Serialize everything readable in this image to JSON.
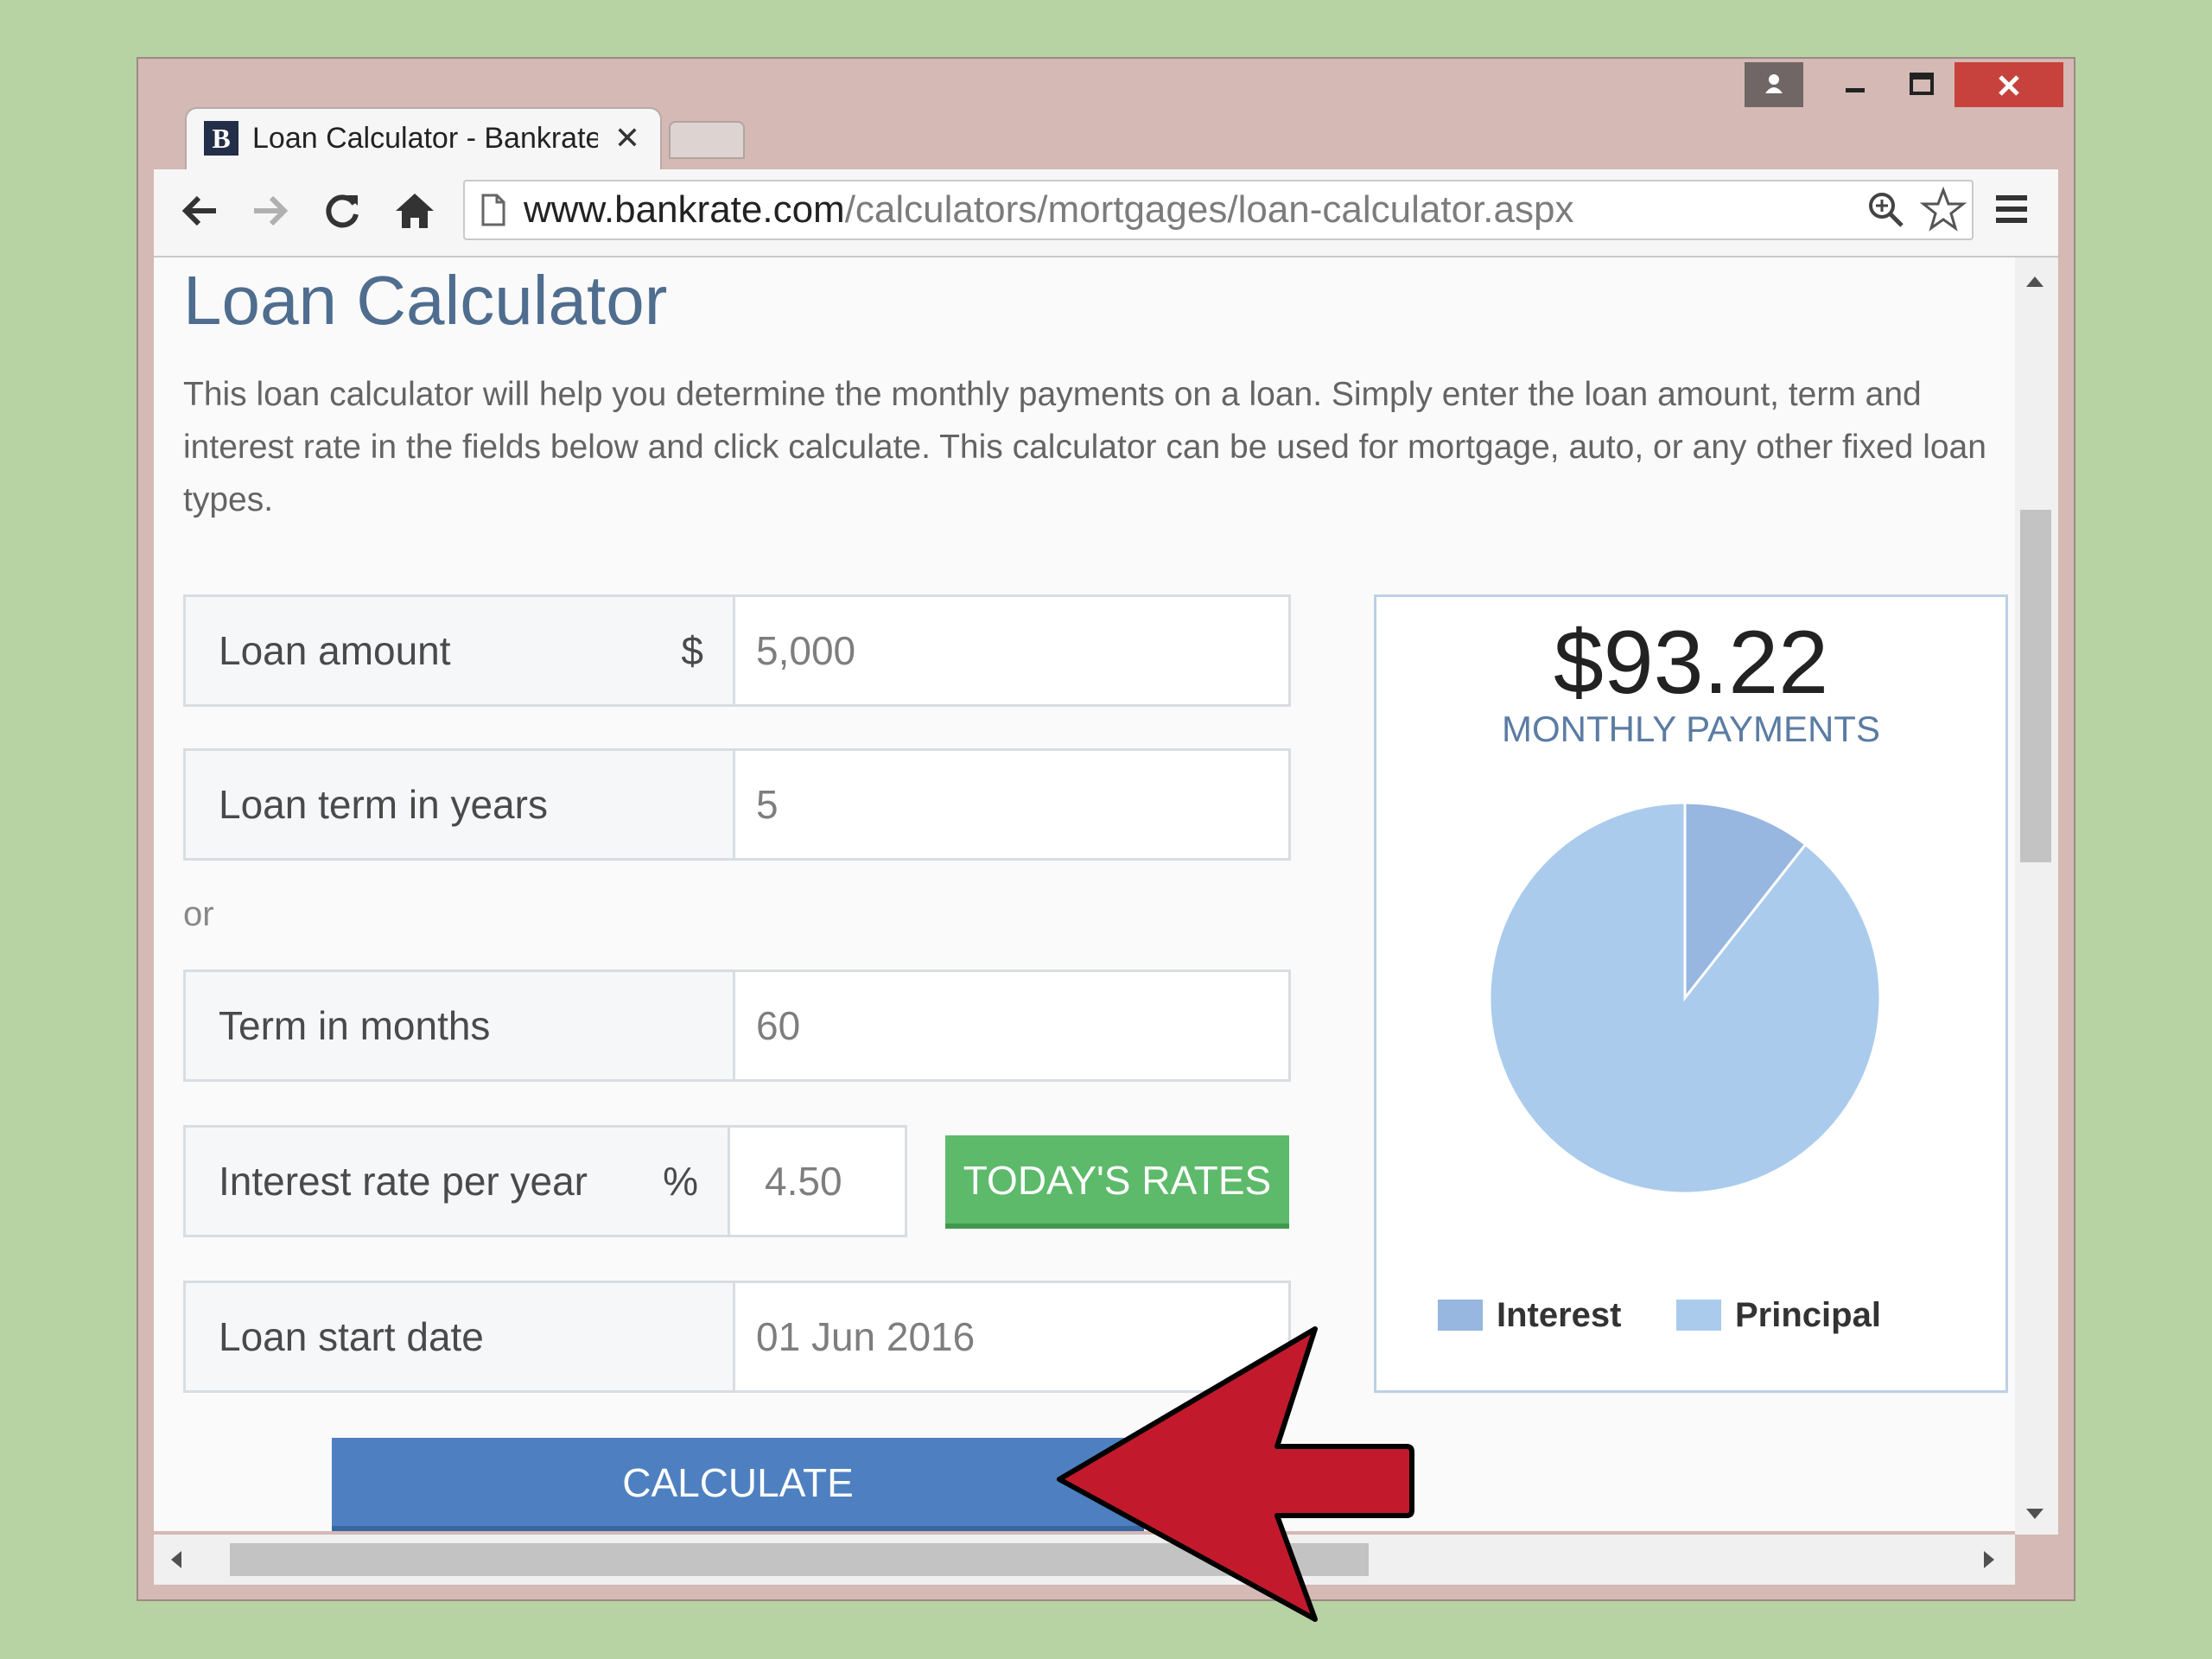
{
  "browser": {
    "tab_title": "Loan Calculator - Bankrate",
    "favicon_letter": "B",
    "url_host": "www.bankrate.com",
    "url_path": "/calculators/mortgages/loan-calculator.aspx"
  },
  "page": {
    "title": "Loan Calculator",
    "intro": "This loan calculator will help you determine the monthly payments on a loan. Simply enter the loan amount, term and interest rate in the fields below and click calculate. This calculator can be used for mortgage, auto, or any other fixed loan types."
  },
  "form": {
    "loan_amount": {
      "label": "Loan amount",
      "unit": "$",
      "value": "5,000"
    },
    "loan_term_years": {
      "label": "Loan term in years",
      "value": "5"
    },
    "or_label": "or",
    "term_months": {
      "label": "Term in months",
      "value": "60"
    },
    "interest_rate": {
      "label": "Interest rate per year",
      "unit": "%",
      "value": "4.50"
    },
    "todays_rates_label": "TODAY'S RATES",
    "start_date": {
      "label": "Loan start date",
      "value": "01 Jun 2016"
    },
    "calculate_label": "CALCULATE"
  },
  "result": {
    "payment": "$93.22",
    "caption": "MONTHLY PAYMENTS"
  },
  "chart_data": {
    "type": "pie",
    "categories": [
      "Interest",
      "Principal"
    ],
    "values": [
      10.6,
      89.4
    ],
    "colors": [
      "#97b6e0",
      "#aacbec"
    ],
    "legend": "bottom"
  },
  "colors": {
    "accent_green": "#5dba6a",
    "accent_blue": "#4e80c1",
    "annotation_arrow": "#c21a2c"
  }
}
